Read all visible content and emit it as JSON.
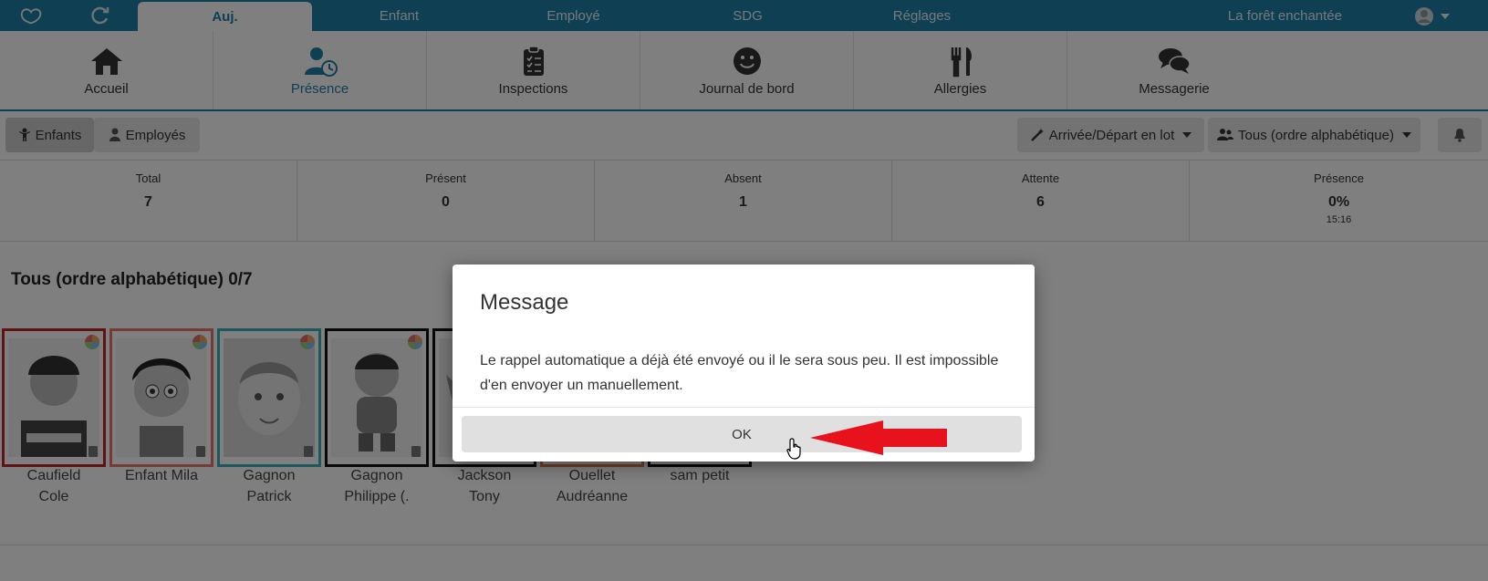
{
  "topnav": {
    "tabs": [
      {
        "label": "Auj.",
        "active": true
      },
      {
        "label": "Enfant"
      },
      {
        "label": "Employé"
      },
      {
        "label": "SDG"
      },
      {
        "label": "Réglages"
      }
    ],
    "organization": "La forêt enchantée",
    "icons": [
      "logo-icon",
      "refresh-icon",
      "user-avatar-icon"
    ]
  },
  "modules": [
    {
      "label": "Accueil",
      "icon": "home-icon"
    },
    {
      "label": "Présence",
      "icon": "user-clock-icon",
      "active": true
    },
    {
      "label": "Inspections",
      "icon": "clipboard-icon"
    },
    {
      "label": "Journal de bord",
      "icon": "smile-icon"
    },
    {
      "label": "Allergies",
      "icon": "utensils-icon"
    },
    {
      "label": "Messagerie",
      "icon": "comments-icon"
    }
  ],
  "toolbar": {
    "enfants_label": "Enfants",
    "employes_label": "Employés",
    "batch_label": "Arrivée/Départ en lot",
    "group_label": "Tous (ordre alphabétique)"
  },
  "stats": [
    {
      "label": "Total",
      "value": "7"
    },
    {
      "label": "Présent",
      "value": "0"
    },
    {
      "label": "Absent",
      "value": "1"
    },
    {
      "label": "Attente",
      "value": "6"
    },
    {
      "label": "Présence",
      "value": "0%",
      "time": "15:16"
    }
  ],
  "group": {
    "title": "Tous (ordre alphabétique) 0/7",
    "children": [
      {
        "line1": "Caufield",
        "line2": "Cole",
        "border": "#c0262d"
      },
      {
        "line1": "Enfant Mila",
        "line2": "",
        "border": "#e4776f"
      },
      {
        "line1": "Gagnon",
        "line2": "Patrick",
        "border": "#3ab0b8"
      },
      {
        "line1": "Gagnon",
        "line2": "Philippe (.",
        "border": "#111111"
      },
      {
        "line1": "Jackson",
        "line2": "Tony",
        "border": "#111111"
      },
      {
        "line1": "Ouellet",
        "line2": "Audréanne",
        "border": "#e07a55"
      },
      {
        "line1": "sam petit",
        "line2": "",
        "border": "#111111"
      }
    ]
  },
  "dialog": {
    "title": "Message",
    "body": "Le rappel automatique a déjà été envoyé ou il le sera sous peu. Il est impossible d'en envoyer un manuellement.",
    "ok_label": "OK"
  },
  "colors": {
    "primary": "#1e7fa6",
    "arrow": "#e8121c"
  }
}
